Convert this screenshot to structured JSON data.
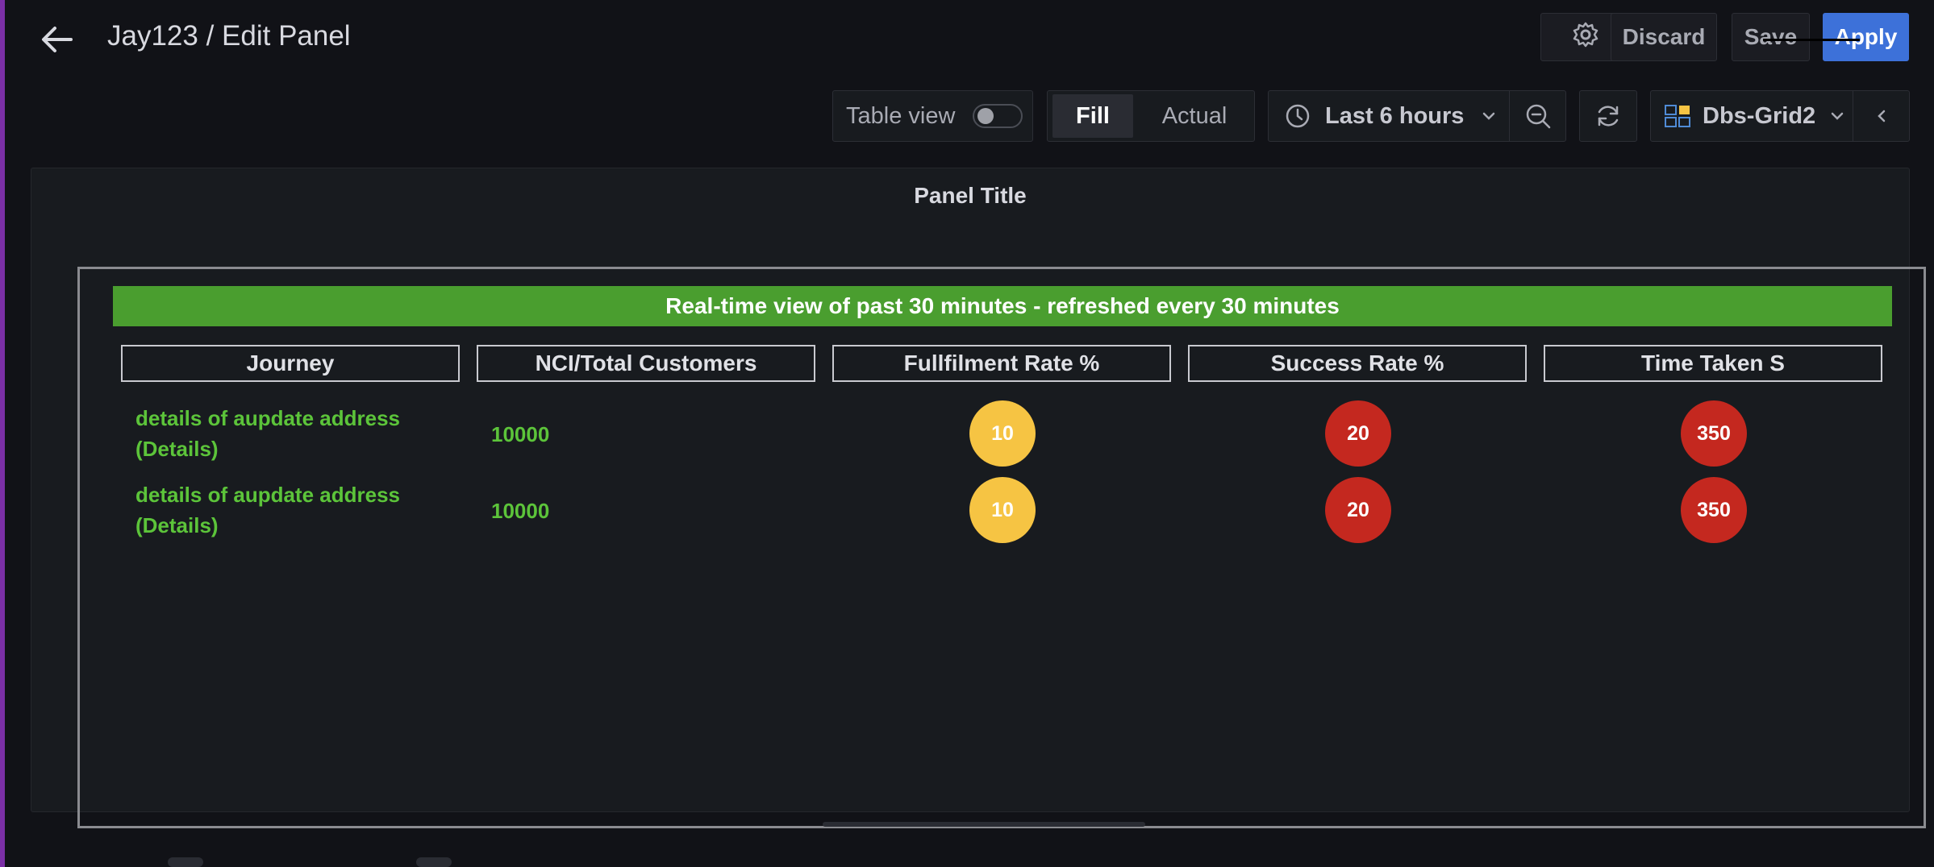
{
  "header": {
    "title": "Jay123 / Edit Panel",
    "discard_label": "Discard",
    "save_label": "Save",
    "apply_label": "Apply"
  },
  "toolbar": {
    "table_view_label": "Table view",
    "table_view_on": false,
    "fill_label": "Fill",
    "actual_label": "Actual",
    "time_range": "Last 6 hours",
    "datasource": "Dbs-Grid2"
  },
  "panel": {
    "title": "Panel Title",
    "banner": "Real-time view of past 30 minutes - refreshed every 30 minutes",
    "columns": [
      "Journey",
      "NCI/Total Customers",
      "Fullfilment Rate %",
      "Success Rate %",
      "Time Taken S"
    ],
    "rows": [
      {
        "journey_line1": "details of aupdate address",
        "journey_line2": "(Details)",
        "nci": "10000",
        "fulfilment": "10",
        "success": "20",
        "time": "350"
      },
      {
        "journey_line1": "details of aupdate address",
        "journey_line2": "(Details)",
        "nci": "10000",
        "fulfilment": "10",
        "success": "20",
        "time": "350"
      }
    ]
  },
  "colors": {
    "banner_green": "#4a9e2f",
    "text_green": "#5cc43a",
    "badge_yellow": "#f6c443",
    "badge_red": "#c4281f",
    "apply_blue": "#3d71d9"
  },
  "icons": [
    "arrow-left-icon",
    "gear-icon",
    "clock-icon",
    "chevron-down-icon",
    "zoom-out-icon",
    "refresh-icon",
    "grid-datasource-icon",
    "chevron-left-icon"
  ]
}
